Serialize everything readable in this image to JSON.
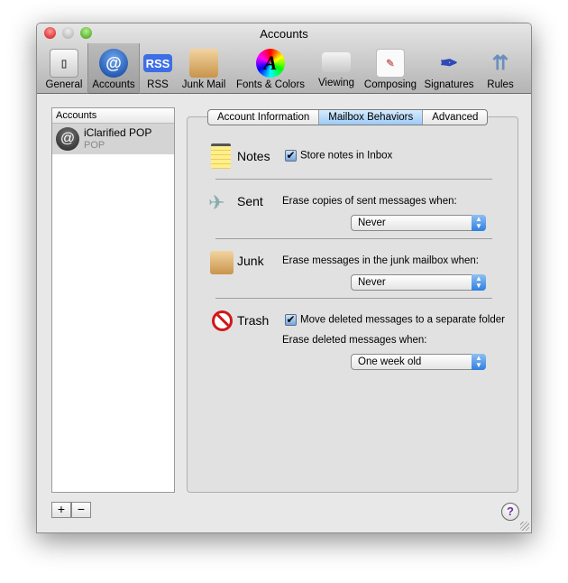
{
  "window": {
    "title": "Accounts"
  },
  "toolbar": [
    {
      "label": "General",
      "icon": "general-switch-icon"
    },
    {
      "label": "Accounts",
      "icon": "at-icon"
    },
    {
      "label": "RSS",
      "icon": "rss-icon",
      "icon_text": "RSS"
    },
    {
      "label": "Junk Mail",
      "icon": "junk-mail-icon"
    },
    {
      "label": "Fonts & Colors",
      "icon": "fonts-colors-icon",
      "icon_text": "A"
    },
    {
      "label": "Viewing",
      "icon": "viewing-icon"
    },
    {
      "label": "Composing",
      "icon": "composing-icon"
    },
    {
      "label": "Signatures",
      "icon": "signatures-icon"
    },
    {
      "label": "Rules",
      "icon": "rules-icon"
    }
  ],
  "sidebar": {
    "header": "Accounts",
    "accounts": [
      {
        "name": "iClarified POP",
        "type": "POP"
      }
    ],
    "add": "+",
    "remove": "−"
  },
  "tabs": [
    "Account Information",
    "Mailbox Behaviors",
    "Advanced"
  ],
  "notes": {
    "title": "Notes",
    "checkbox": "Store notes in Inbox",
    "checked": true
  },
  "sent": {
    "title": "Sent",
    "label": "Erase copies of sent messages when:",
    "value": "Never"
  },
  "junk": {
    "title": "Junk",
    "label": "Erase messages in the junk mailbox when:",
    "value": "Never"
  },
  "trash": {
    "title": "Trash",
    "checkbox": "Move deleted messages to a separate folder",
    "checked": true,
    "label": "Erase deleted messages when:",
    "value": "One week old"
  },
  "help": "?",
  "colors": {
    "accent": "#3b82e0",
    "selected_row": "#d4d4d4"
  }
}
